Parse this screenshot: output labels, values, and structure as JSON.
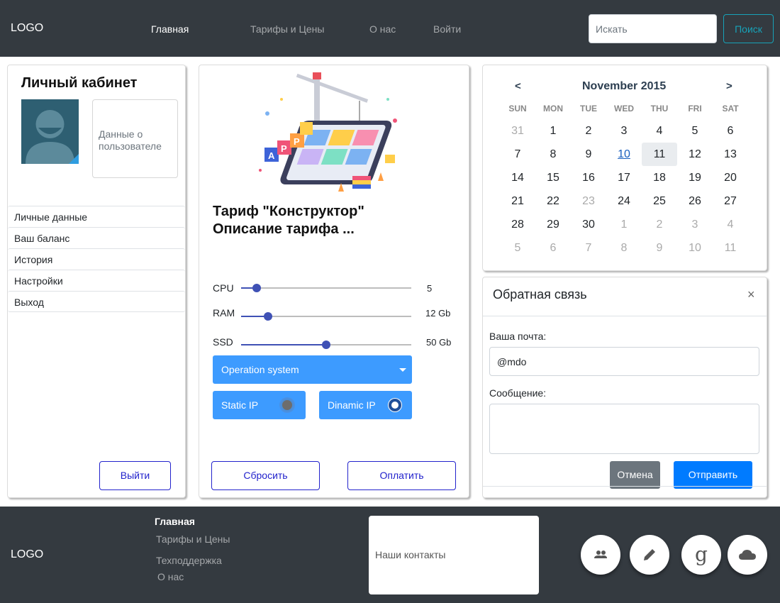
{
  "header": {
    "logo": "LOGO",
    "nav": [
      {
        "label": "Главная"
      },
      {
        "label": "Тарифы и Цены"
      },
      {
        "label": "О нас"
      },
      {
        "label": "Войти"
      }
    ],
    "search": {
      "placeholder": "Искать",
      "button": "Поиск"
    }
  },
  "profile": {
    "title": "Личный кабинет",
    "user_data": "Данные о пользователе",
    "menu": [
      {
        "label": "Личные данные"
      },
      {
        "label": "Ваш баланс"
      },
      {
        "label": "История"
      },
      {
        "label": "Настройки"
      },
      {
        "label": "Выход"
      }
    ],
    "logout_button": "Выйти"
  },
  "tariff": {
    "title": "Тариф \"Конструктор\"",
    "description": "Описание тарифа ...",
    "sliders": [
      {
        "label": "CPU",
        "value": "5",
        "fill": 0.09
      },
      {
        "label": "RAM",
        "value": "12 Gb",
        "fill": 0.16
      },
      {
        "label": "SSD",
        "value": "50 Gb",
        "fill": 0.5
      }
    ],
    "os_select": "Operation system",
    "static_ip": "Static IP",
    "dynamic_ip": "Dinamic IP",
    "reset_button": "Сбросить",
    "pay_button": "Оплатить"
  },
  "calendar": {
    "prev": "<",
    "next": ">",
    "month": "November 2015",
    "weekdays": [
      "SUN",
      "MON",
      "TUE",
      "WED",
      "THU",
      "FRI",
      "SAT"
    ],
    "days": [
      {
        "d": "31",
        "m": true
      },
      {
        "d": "1"
      },
      {
        "d": "2"
      },
      {
        "d": "3"
      },
      {
        "d": "4"
      },
      {
        "d": "5"
      },
      {
        "d": "6"
      },
      {
        "d": "7"
      },
      {
        "d": "8"
      },
      {
        "d": "9"
      },
      {
        "d": "10",
        "link": true
      },
      {
        "d": "11",
        "sel": true
      },
      {
        "d": "12"
      },
      {
        "d": "13"
      },
      {
        "d": "14"
      },
      {
        "d": "15"
      },
      {
        "d": "16"
      },
      {
        "d": "17"
      },
      {
        "d": "18"
      },
      {
        "d": "19"
      },
      {
        "d": "20"
      },
      {
        "d": "21"
      },
      {
        "d": "22"
      },
      {
        "d": "23",
        "m": true
      },
      {
        "d": "24"
      },
      {
        "d": "25"
      },
      {
        "d": "26"
      },
      {
        "d": "27"
      },
      {
        "d": "28"
      },
      {
        "d": "29"
      },
      {
        "d": "30"
      },
      {
        "d": "1",
        "m": true
      },
      {
        "d": "2",
        "m": true
      },
      {
        "d": "3",
        "m": true
      },
      {
        "d": "4",
        "m": true
      },
      {
        "d": "5",
        "m": true
      },
      {
        "d": "6",
        "m": true
      },
      {
        "d": "7",
        "m": true
      },
      {
        "d": "8",
        "m": true
      },
      {
        "d": "9",
        "m": true
      },
      {
        "d": "10",
        "m": true
      },
      {
        "d": "11",
        "m": true
      }
    ]
  },
  "feedback": {
    "title": "Обратная связь",
    "close": "×",
    "email_label": "Ваша почта:",
    "email_value": "@mdo",
    "message_label": "Сообщение:",
    "cancel_button": "Отмена",
    "send_button": "Отправить"
  },
  "footer": {
    "logo": "LOGO",
    "links": [
      {
        "label": "Главная"
      },
      {
        "label": "Тарифы и Цены"
      },
      {
        "label": "Техподдержка"
      },
      {
        "label": "О нас"
      }
    ],
    "contacts": "Наши контакты",
    "social_icons": [
      "people-icon",
      "pencil-icon",
      "google-icon",
      "cloud-icon"
    ]
  }
}
